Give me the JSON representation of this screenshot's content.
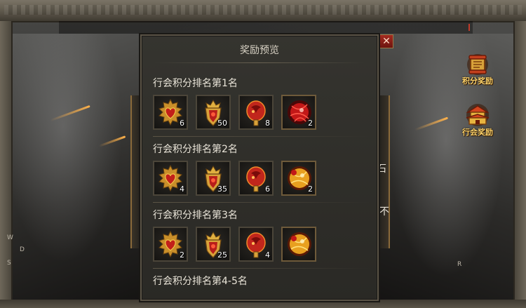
{
  "dialog": {
    "title": "奖励预览",
    "close_label": "✕",
    "ranks": [
      {
        "title": "行会积分排名第1名",
        "items": [
          {
            "icon": "heart-emblem-icon",
            "count": "6"
          },
          {
            "icon": "crowned-shield-icon",
            "count": "50"
          },
          {
            "icon": "red-dragon-gem-icon",
            "count": "8"
          },
          {
            "icon": "red-orb-icon",
            "count": "2"
          }
        ]
      },
      {
        "title": "行会积分排名第2名",
        "items": [
          {
            "icon": "heart-emblem-icon",
            "count": "4"
          },
          {
            "icon": "crowned-shield-icon",
            "count": "35"
          },
          {
            "icon": "red-dragon-gem-icon",
            "count": "6"
          },
          {
            "icon": "golden-orb-icon",
            "count": "2"
          }
        ]
      },
      {
        "title": "行会积分排名第3名",
        "items": [
          {
            "icon": "heart-emblem-icon",
            "count": "2"
          },
          {
            "icon": "crowned-shield-icon",
            "count": "25"
          },
          {
            "icon": "red-dragon-gem-icon",
            "count": "4"
          },
          {
            "icon": "golden-orb-icon",
            "count": ""
          }
        ]
      },
      {
        "title": "行会积分排名第4-5名",
        "items": []
      }
    ]
  },
  "side_buttons": {
    "points_reward": "积分奖励",
    "guild_reward": "行会奖励"
  },
  "background_text": {
    "cut_char_1": "石",
    "cut_char_2": "不",
    "corner_w": "W",
    "corner_d": "D",
    "corner_s": "S",
    "corner_r": "R"
  },
  "colors": {
    "accent_gold": "#ffd36a",
    "close_red": "#a42b20"
  }
}
